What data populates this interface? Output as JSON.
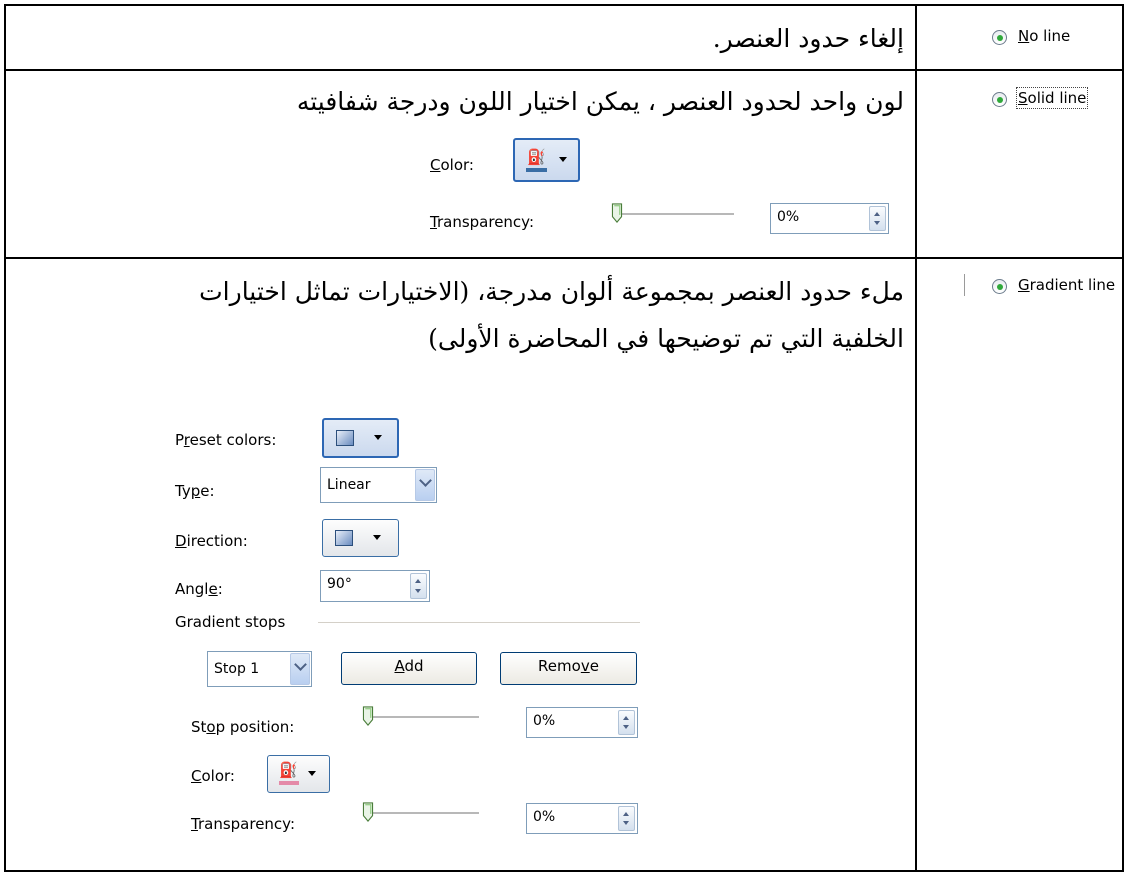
{
  "rows": [
    {
      "option_label": "No line",
      "mnemonic": "N",
      "rest": "o line",
      "description": "إلغاء حدود العنصر."
    },
    {
      "option_label": "Solid line",
      "mnemonic": "S",
      "rest": "olid line",
      "description": "لون واحد لحدود العنصر ، يمكن اختيار اللون ودرجة شفافيته",
      "color_label": {
        "m": "C",
        "rest": "olor:"
      },
      "transparency_label": {
        "m": "T",
        "rest": "ransparency:"
      },
      "transparency_value": "0%",
      "transparency_level": 0
    },
    {
      "option_label": "Gradient line",
      "mnemonic": "G",
      "rest": "radient line",
      "description_line1": "ملء حدود العنصر بمجموعة ألوان مدرجة، (الاختيارات تماثل اختيارات",
      "description_line2": "الخلفية التي تم توضيحها في المحاضرة الأولى)",
      "preset_label": {
        "pre": "P",
        "m": "r",
        "rest": "eset colors:"
      },
      "type_label": {
        "pre": "Ty",
        "m": "p",
        "rest": "e:"
      },
      "type_value": "Linear",
      "direction_label": {
        "m": "D",
        "rest": "irection:"
      },
      "angle_label": {
        "pre": "Angl",
        "m": "e",
        "rest": ":"
      },
      "angle_value": "90°",
      "gradient_stops_heading": "Gradient stops",
      "stop_select_value": "Stop 1",
      "add_label": {
        "m": "A",
        "rest": "dd"
      },
      "remove_label": {
        "pre": "Remo",
        "m": "v",
        "rest": "e"
      },
      "stop_position_label": {
        "pre": "St",
        "m": "o",
        "rest": "p position:"
      },
      "stop_position_value": "0%",
      "stop_position_level": 0,
      "color_label": {
        "m": "C",
        "rest": "olor:"
      },
      "transparency_label": {
        "m": "T",
        "rest": "ransparency:"
      },
      "transparency_value": "0%",
      "transparency_level": 0
    }
  ],
  "colors": {
    "radio_dot": "#2fa83a",
    "solid_color_bar": "#3a6ea5",
    "gradient_color_bar": "#e48aa8"
  }
}
